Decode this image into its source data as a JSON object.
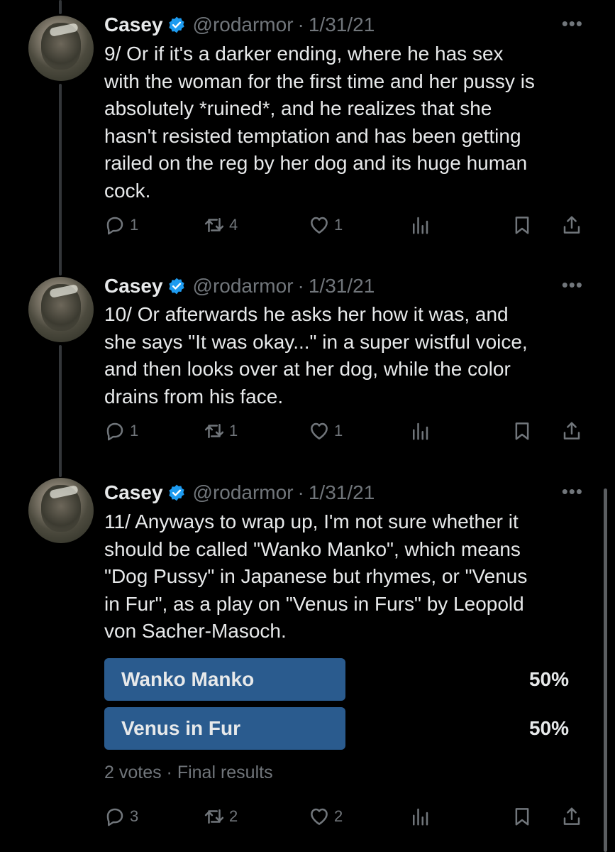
{
  "colors": {
    "background": "#000000",
    "text": "#e7e9ea",
    "muted": "#71767b",
    "verified": "#1d9bf0",
    "poll_bar": "#2a5b8e"
  },
  "tweets": [
    {
      "name": "Casey",
      "handle": "@rodarmor",
      "sep": "·",
      "date": "1/31/21",
      "more": "•••",
      "text": "9/ Or if it's a darker ending, where he has sex\nwith the woman for the first time and her pussy is\nabsolutely *ruined*, and he realizes that she\nhasn't resisted temptation and has been getting\nrailed on the reg by her dog and its huge human\ncock.",
      "replies": "1",
      "retweets": "4",
      "likes": "1"
    },
    {
      "name": "Casey",
      "handle": "@rodarmor",
      "sep": "·",
      "date": "1/31/21",
      "more": "•••",
      "text": "10/ Or afterwards he asks her how it was, and\nshe says \"It was okay...\" in a super wistful voice,\nand then looks over at her dog, while the color\ndrains from his face.",
      "replies": "1",
      "retweets": "1",
      "likes": "1"
    },
    {
      "name": "Casey",
      "handle": "@rodarmor",
      "sep": "·",
      "date": "1/31/21",
      "more": "•••",
      "text": "11/ Anyways to wrap up, I'm not sure whether it\nshould be called \"Wanko Manko\", which means\n\"Dog Pussy\" in Japanese but rhymes, or \"Venus\nin Fur\", as a play on \"Venus in Furs\" by Leopold\nvon Sacher-Masoch.",
      "replies": "3",
      "retweets": "2",
      "likes": "2"
    }
  ],
  "poll": {
    "options": [
      {
        "label": "Wanko Manko",
        "percent": "50%",
        "fraction": 0.5
      },
      {
        "label": "Venus in Fur",
        "percent": "50%",
        "fraction": 0.5
      }
    ],
    "meta": "2 votes · Final results"
  },
  "icons": {
    "reply": "reply-icon",
    "retweet": "retweet-icon",
    "like": "heart-icon",
    "views": "views-icon",
    "bookmark": "bookmark-icon",
    "share": "share-icon",
    "verified": "verified-badge-icon",
    "more": "more-icon"
  }
}
